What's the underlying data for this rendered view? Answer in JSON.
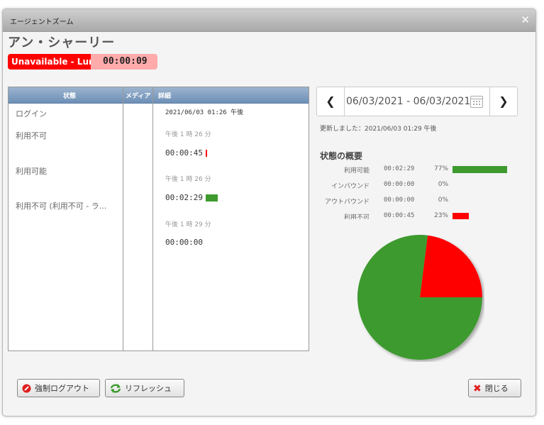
{
  "dialog": {
    "title": "エージェントズーム"
  },
  "agent": {
    "name": "アン・シャーリー",
    "status_label": "Unavailable - Lunch",
    "status_timer": "00:00:09"
  },
  "table": {
    "headers": [
      "状態",
      "メディア",
      "詳細"
    ],
    "states": [
      "ログイン",
      "利用不可",
      "利用可能",
      "利用不可 (利用不可 - ラ..."
    ],
    "details": [
      "2021/06/03 01:26 午後",
      "午後 1 時 26 分",
      "00:00:45",
      "午後 1 時 26 分",
      "00:02:29",
      "午後 1 時 29 分",
      "00:00:00"
    ]
  },
  "date": {
    "range": "06/03/2021 - 06/03/2021"
  },
  "updated": "更新しました：2021/06/03 01:29 午後",
  "summary": {
    "title": "状態の概要",
    "rows": [
      {
        "label": "利用可能",
        "time": "00:02:29",
        "pct": "77%",
        "value": 77,
        "color": "#3e9a2f"
      },
      {
        "label": "インバウンド",
        "time": "00:00:00",
        "pct": "0%",
        "value": 0,
        "color": "#3e9a2f"
      },
      {
        "label": "アウトバウンド",
        "time": "00:00:00",
        "pct": "0%",
        "value": 0,
        "color": "#3e9a2f"
      },
      {
        "label": "利用不可",
        "time": "00:00:45",
        "pct": "23%",
        "value": 23,
        "color": "#ff0000"
      }
    ]
  },
  "colors": {
    "available": "#3e9a2f",
    "unavailable": "#ff0000"
  },
  "buttons": {
    "force_logout": "強制ログアウト",
    "refresh": "リフレッシュ",
    "close": "閉じる"
  }
}
